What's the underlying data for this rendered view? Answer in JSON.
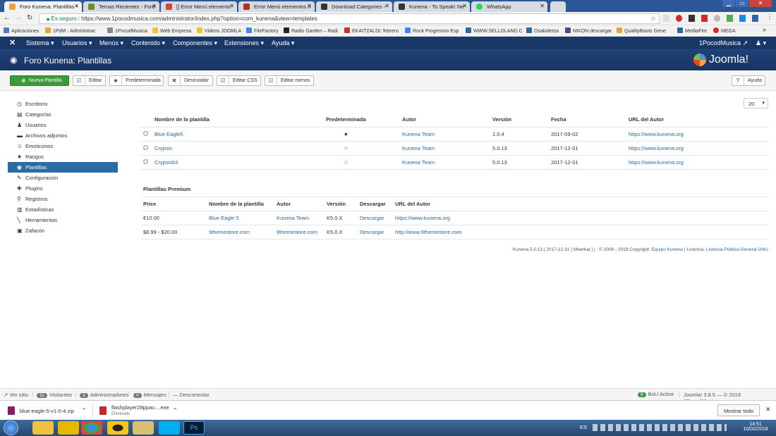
{
  "browser": {
    "tabs": [
      {
        "label": "Foro Kunena: Plantillas -",
        "color": "#e8a33a"
      },
      {
        "label": "Temas Recientes - Foro",
        "color": "#6b8e23"
      },
      {
        "label": "[] Error Menú elemento",
        "color": "#d44638"
      },
      {
        "label": "Error Menú elementos n",
        "color": "#b82a2a"
      },
      {
        "label": "Download Categories -",
        "color": "#333333"
      },
      {
        "label": "Kunena - To Speak! Ne",
        "color": "#333333"
      },
      {
        "label": "WhatsApp",
        "color": "#25d366"
      }
    ],
    "secure_label": "Es seguro",
    "url": "https://www.1pocodmusica.com/administrator/index.php?option=com_kunena&view=templates",
    "bookmarks": [
      {
        "label": "Aplicaciones",
        "color": "#4a7bd0"
      },
      {
        "label": "1PdM - Administrac",
        "color": "#e8a33a"
      },
      {
        "label": "1PocodMusica",
        "color": "#888888"
      },
      {
        "label": "Web Empresa",
        "color": "#f0c040"
      },
      {
        "label": "Videos JOOMLA",
        "color": "#f0c040"
      },
      {
        "label": "FileFactory",
        "color": "#4285f4"
      },
      {
        "label": "Radio Garden – Radi",
        "color": "#222222"
      },
      {
        "label": "EKAITZALDI: febrero",
        "color": "#c0392b"
      },
      {
        "label": "Rock Progresivo Esp",
        "color": "#4285f4"
      },
      {
        "label": "WWW.SELLOLAND.C",
        "color": "#2a67a6"
      },
      {
        "label": "Osakidetza",
        "color": "#2a67a6"
      },
      {
        "label": "NIKON descargar",
        "color": "#4a4a9a"
      },
      {
        "label": "QualityBootz Gene",
        "color": "#e8a33a"
      },
      {
        "label": "MediaFire",
        "color": "#2a67a6"
      },
      {
        "label": "MEGA",
        "color": "#d9272e"
      }
    ],
    "more": "»"
  },
  "joomla": {
    "menu": [
      "Sistema",
      "Usuarios",
      "Menús",
      "Contenido",
      "Componentes",
      "Extensiones",
      "Ayuda"
    ],
    "site_name": "1PocodMusica",
    "page_title": "Foro Kunena: Plantillas",
    "logo_text": "Joomla!",
    "toolbar": {
      "new": "Nueva Plantilla",
      "edit": "Editar",
      "default": "Predeterminada",
      "uninstall": "Desinstalar",
      "edit_css": "Editar CSS",
      "edit_less": "Editar menos",
      "help": "Ayuda"
    }
  },
  "sidebar": {
    "items": [
      {
        "label": "Escritorio",
        "icon": "◷"
      },
      {
        "label": "Categorías",
        "icon": "▤"
      },
      {
        "label": "Usuarios",
        "icon": "♟"
      },
      {
        "label": "Archivos adjuntos",
        "icon": "▬"
      },
      {
        "label": "Emoticonos",
        "icon": "☺"
      },
      {
        "label": "Rangos",
        "icon": "★"
      },
      {
        "label": "Plantillas",
        "icon": "◉"
      },
      {
        "label": "Configuración",
        "icon": "✎"
      },
      {
        "label": "Plugins",
        "icon": "✚"
      },
      {
        "label": "Registros",
        "icon": "⚲"
      },
      {
        "label": "Estadísticas",
        "icon": "▥"
      },
      {
        "label": "Herramientas",
        "icon": "╲"
      },
      {
        "label": "Zafacón",
        "icon": "▣"
      }
    ],
    "active": "Plantillas"
  },
  "templates": {
    "limit": "20",
    "headers": [
      "Nombre de la plantilla",
      "Predeterminada",
      "Autor",
      "Versión",
      "Fecha",
      "URL del Autor"
    ],
    "rows": [
      {
        "name": "Blue Eagle5",
        "default": "★",
        "author": "Kunena Team",
        "version": "1.0.4",
        "date": "2017-09-02",
        "url": "https://www.kunena.org"
      },
      {
        "name": "Crypsis",
        "default": "☆",
        "author": "Kunena Team",
        "version": "5.0.13",
        "date": "2017-12-31",
        "url": "https://www.kunena.org"
      },
      {
        "name": "Crypsisb3",
        "default": "☆",
        "author": "Kunena Team",
        "version": "5.0.13",
        "date": "2017-12-31",
        "url": "https://www.kunena.org"
      }
    ]
  },
  "premium": {
    "title": "Plantillas Premium",
    "headers": [
      "Price",
      "Nombre de la plantilla",
      "Autor",
      "Versión",
      "Descargar",
      "URL del Autor"
    ],
    "rows": [
      {
        "price": "€10.00",
        "name": "Blue Eagle 5",
        "author": "Kunena Team",
        "version": "K5.0.X",
        "download": "Descargar",
        "url": "https://www.kunena.org"
      },
      {
        "price": "$8.99 - $20.00",
        "name": "9themestore.com",
        "author": "9themestore.com",
        "version": "K5.0.X",
        "download": "Descargar",
        "url": "http://www.9themestore.com"
      }
    ]
  },
  "footer": {
    "text": "Kunena 5.0.13 | 2017-12-31 [ Meerkat ] | : © 2008 - 2018 Copyright:",
    "team_link": "Equipo Kunena",
    "license_label": "| Licencia:",
    "license_link": "Licencia Pública General GNU"
  },
  "status": {
    "view_site": "Ver sitio",
    "visitors_count": "11",
    "visitors": "Visitantes",
    "admins_count": "3",
    "admins": "Administradores",
    "messages_count": "0",
    "messages": "Mensajes",
    "logout": "Desconectar",
    "bou_count": "9",
    "bou": "BoU Active",
    "version": "Joomla! 3.8.5 — © 2018 1PocodMusica"
  },
  "downloads": {
    "items": [
      {
        "name": "blue-eagle-5-v1-0-4.zip",
        "sub": ""
      },
      {
        "name": "flashplayer28ppau....exe",
        "sub": "Eliminado"
      }
    ],
    "show_all": "Mostrar todo"
  },
  "taskbar": {
    "lang": "ES",
    "time": "14:51",
    "date": "10/02/2018"
  }
}
